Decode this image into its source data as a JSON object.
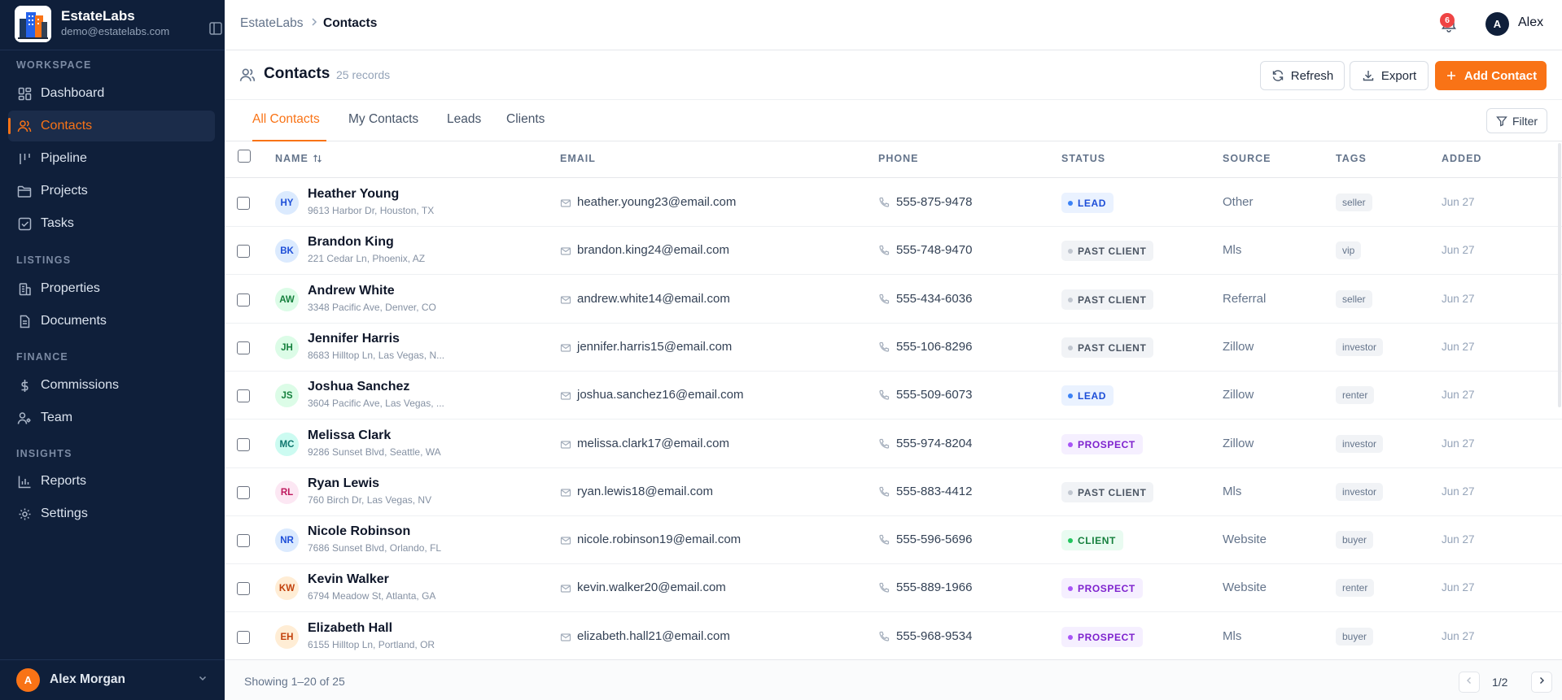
{
  "sidebar": {
    "brand_name": "EstateLabs",
    "brand_email": "demo@estatelabs.com",
    "sections": {
      "workspace": "WORKSPACE",
      "listings": "LISTINGS",
      "finance": "FINANCE",
      "insights": "INSIGHTS"
    },
    "items": [
      {
        "label": "Dashboard",
        "icon": "dashboard-icon"
      },
      {
        "label": "Contacts",
        "icon": "users-icon",
        "active": true
      },
      {
        "label": "Pipeline",
        "icon": "pipeline-icon"
      },
      {
        "label": "Projects",
        "icon": "folder-icon"
      },
      {
        "label": "Tasks",
        "icon": "checkbox-icon"
      },
      {
        "label": "Properties",
        "icon": "building-icon"
      },
      {
        "label": "Documents",
        "icon": "document-icon"
      },
      {
        "label": "Commissions",
        "icon": "dollar-icon"
      },
      {
        "label": "Team",
        "icon": "team-icon"
      },
      {
        "label": "Reports",
        "icon": "chart-icon"
      },
      {
        "label": "Settings",
        "icon": "gear-icon"
      }
    ],
    "user": {
      "initial": "A",
      "name": "Alex Morgan"
    },
    "accent": "#f97316",
    "background": "#0f1f3a"
  },
  "topbar": {
    "breadcrumb": [
      "EstateLabs",
      "Contacts"
    ],
    "notifications": "6",
    "user_initial": "A",
    "user_name": "Alex"
  },
  "header": {
    "title": "Contacts",
    "count": "25 records",
    "buttons": {
      "refresh": "Refresh",
      "export": "Export",
      "add": "Add Contact"
    }
  },
  "tabs": [
    "All Contacts",
    "My Contacts",
    "Leads",
    "Clients"
  ],
  "filter_label": "Filter",
  "table": {
    "columns": [
      "NAME",
      "EMAIL",
      "PHONE",
      "STATUS",
      "SOURCE",
      "TAGS",
      "ADDED"
    ],
    "rows": [
      {
        "initials": "HY",
        "name": "Heather Young",
        "address": "9613 Harbor Dr, Houston, TX",
        "email": "heather.young23@email.com",
        "phone": "555-875-9478",
        "status": "LEAD",
        "source": "Other",
        "tag": "seller",
        "added": "Jun 27"
      },
      {
        "initials": "BK",
        "name": "Brandon King",
        "address": "221 Cedar Ln, Phoenix, AZ",
        "email": "brandon.king24@email.com",
        "phone": "555-748-9470",
        "status": "PAST CLIENT",
        "source": "Mls",
        "tag": "vip",
        "added": "Jun 27"
      },
      {
        "initials": "AW",
        "name": "Andrew White",
        "address": "3348 Pacific Ave, Denver, CO",
        "email": "andrew.white14@email.com",
        "phone": "555-434-6036",
        "status": "PAST CLIENT",
        "source": "Referral",
        "tag": "seller",
        "added": "Jun 27"
      },
      {
        "initials": "JH",
        "name": "Jennifer Harris",
        "address": "8683 Hilltop Ln, Las Vegas, N...",
        "email": "jennifer.harris15@email.com",
        "phone": "555-106-8296",
        "status": "PAST CLIENT",
        "source": "Zillow",
        "tag": "investor",
        "added": "Jun 27"
      },
      {
        "initials": "JS",
        "name": "Joshua Sanchez",
        "address": "3604 Pacific Ave, Las Vegas, ...",
        "email": "joshua.sanchez16@email.com",
        "phone": "555-509-6073",
        "status": "LEAD",
        "source": "Zillow",
        "tag": "renter",
        "added": "Jun 27"
      },
      {
        "initials": "MC",
        "name": "Melissa Clark",
        "address": "9286 Sunset Blvd, Seattle, WA",
        "email": "melissa.clark17@email.com",
        "phone": "555-974-8204",
        "status": "PROSPECT",
        "source": "Zillow",
        "tag": "investor",
        "added": "Jun 27"
      },
      {
        "initials": "RL",
        "name": "Ryan Lewis",
        "address": "760 Birch Dr, Las Vegas, NV",
        "email": "ryan.lewis18@email.com",
        "phone": "555-883-4412",
        "status": "PAST CLIENT",
        "source": "Mls",
        "tag": "investor",
        "added": "Jun 27"
      },
      {
        "initials": "NR",
        "name": "Nicole Robinson",
        "address": "7686 Sunset Blvd, Orlando, FL",
        "email": "nicole.robinson19@email.com",
        "phone": "555-596-5696",
        "status": "CLIENT",
        "source": "Website",
        "tag": "buyer",
        "added": "Jun 27"
      },
      {
        "initials": "KW",
        "name": "Kevin Walker",
        "address": "6794 Meadow St, Atlanta, GA",
        "email": "kevin.walker20@email.com",
        "phone": "555-889-1966",
        "status": "PROSPECT",
        "source": "Website",
        "tag": "renter",
        "added": "Jun 27"
      },
      {
        "initials": "EH",
        "name": "Elizabeth Hall",
        "address": "6155 Hilltop Ln, Portland, OR",
        "email": "elizabeth.hall21@email.com",
        "phone": "555-968-9534",
        "status": "PROSPECT",
        "source": "Mls",
        "tag": "buyer",
        "added": "Jun 27"
      }
    ]
  },
  "footer": {
    "showing": "Showing 1–20 of 25",
    "page": "1/2"
  }
}
